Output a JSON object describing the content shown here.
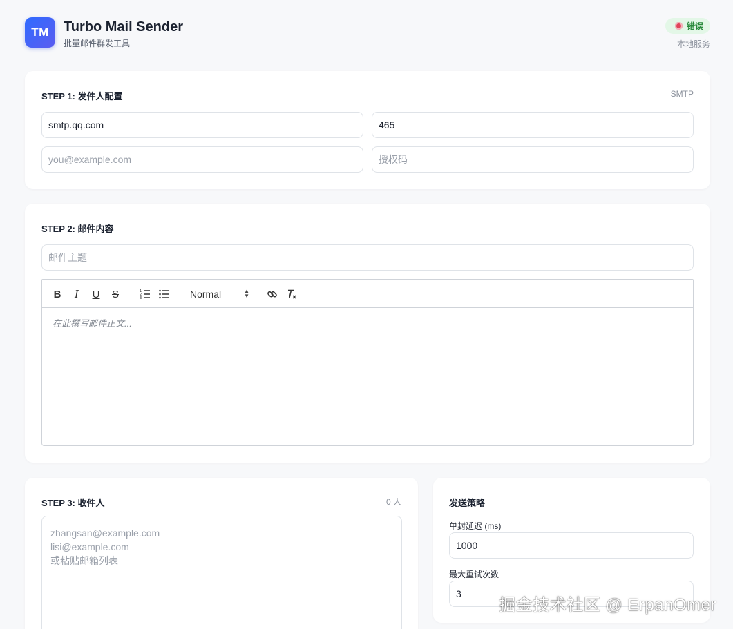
{
  "header": {
    "logo_text": "TM",
    "title": "Turbo Mail Sender",
    "subtitle": "批量邮件群发工具",
    "status": {
      "label": "错误",
      "color": "#e0445a",
      "bg": "#e3f7e7",
      "text_color": "#2a8a3d"
    },
    "service_label": "本地服务"
  },
  "step1": {
    "title": "STEP 1: 发件人配置",
    "meta": "SMTP",
    "smtp_host": {
      "value": "smtp.qq.com",
      "placeholder": ""
    },
    "smtp_port": {
      "value": "465",
      "placeholder": ""
    },
    "sender_email": {
      "value": "",
      "placeholder": "you@example.com"
    },
    "auth_code": {
      "value": "",
      "placeholder": "授权码"
    }
  },
  "step2": {
    "title": "STEP 2: 邮件内容",
    "subject": {
      "value": "",
      "placeholder": "邮件主题"
    },
    "toolbar": {
      "bold": "B",
      "italic": "I",
      "underline": "U",
      "strike": "S",
      "format": "Normal"
    },
    "editor_placeholder": "在此撰写邮件正文..."
  },
  "step3": {
    "title": "STEP 3: 收件人",
    "count": "0 人",
    "recipients_placeholder_lines": [
      "zhangsan@example.com",
      "lisi@example.com",
      "或粘贴邮箱列表"
    ]
  },
  "strategy": {
    "title": "发送策略",
    "delay_label": "单封延迟 (ms)",
    "delay_value": "1000",
    "retry_label": "最大重试次数",
    "retry_value": "3"
  },
  "watermark": "掘金技术社区 @ ErpanOmer",
  "colors": {
    "accent": "#2f6bff",
    "background": "#f7f8fa"
  }
}
